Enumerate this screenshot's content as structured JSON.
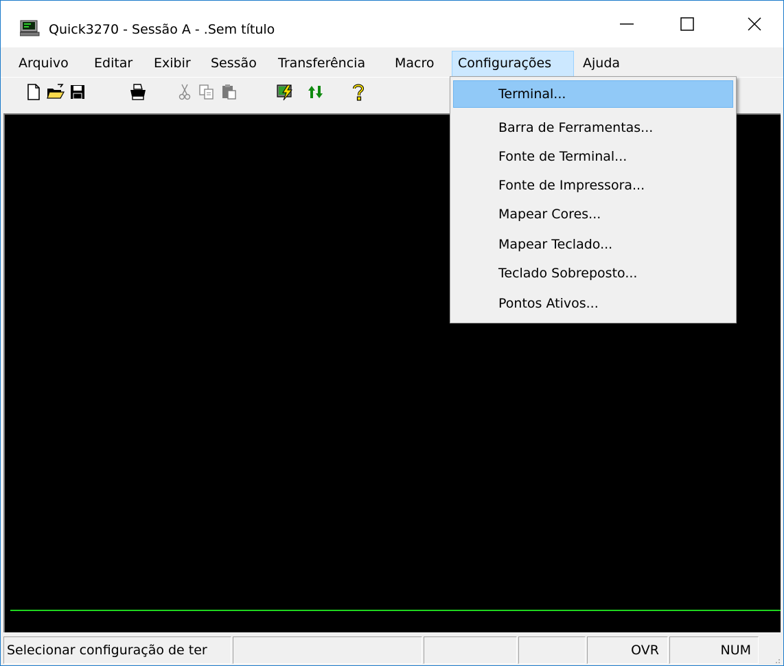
{
  "window": {
    "title": "Quick3270 - Sessão A - .Sem título",
    "icons": {
      "app": "terminal-monitor-icon",
      "minimize": "minimize-icon",
      "maximize": "maximize-icon",
      "close": "close-icon"
    }
  },
  "menubar": {
    "items": [
      {
        "label": "Arquivo"
      },
      {
        "label": "Editar"
      },
      {
        "label": "Exibir"
      },
      {
        "label": "Sessão"
      },
      {
        "label": "Transferência"
      },
      {
        "label": "Macro"
      },
      {
        "label": "Configurações",
        "active": true
      },
      {
        "label": "Ajuda"
      }
    ]
  },
  "toolbar": {
    "buttons": [
      {
        "icon": "new-file-icon"
      },
      {
        "icon": "open-folder-icon"
      },
      {
        "icon": "save-disk-icon"
      },
      {
        "icon": "print-icon"
      },
      {
        "icon": "cut-icon",
        "disabled": true
      },
      {
        "icon": "copy-icon",
        "disabled": true
      },
      {
        "icon": "paste-icon",
        "disabled": true
      },
      {
        "icon": "connect-lightning-icon"
      },
      {
        "icon": "transfer-arrows-icon"
      },
      {
        "icon": "help-question-icon"
      }
    ]
  },
  "dropdown": {
    "items": [
      {
        "label": "Terminal...",
        "highlighted": true
      },
      {
        "label": "Barra de Ferramentas..."
      },
      {
        "label": "Fonte de Terminal..."
      },
      {
        "label": "Fonte de Impressora..."
      },
      {
        "label": "Mapear Cores..."
      },
      {
        "label": "Mapear Teclado..."
      },
      {
        "label": "Teclado Sobreposto..."
      },
      {
        "label": "Pontos Ativos..."
      }
    ]
  },
  "statusbar": {
    "message": "Selecionar configuração de ter",
    "ovr": "OVR",
    "num": "NUM"
  },
  "colors": {
    "terminal_background": "#000000",
    "terminal_status_line": "#1fd61f",
    "menu_highlight": "#91c9f7",
    "menubar_active": "#cce8ff"
  }
}
